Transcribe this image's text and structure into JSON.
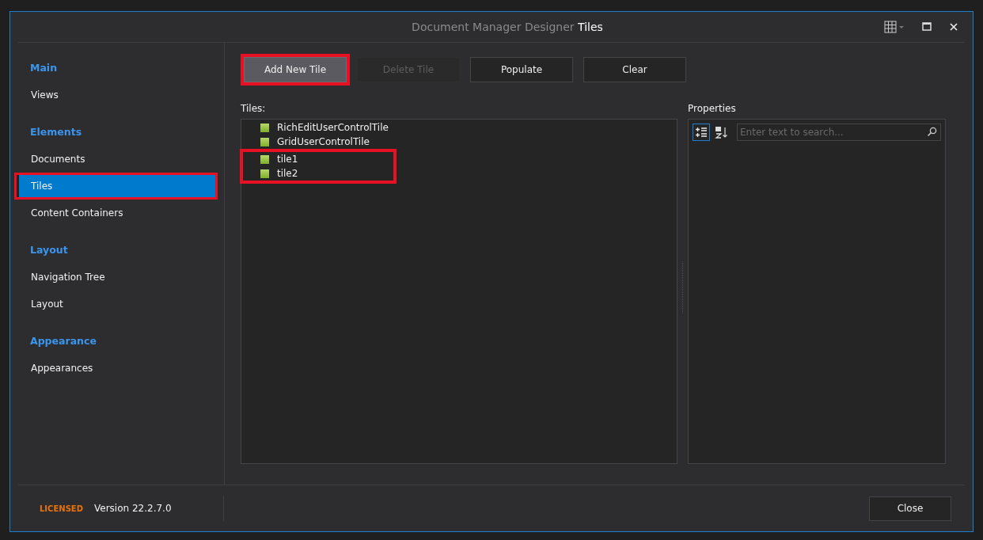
{
  "window": {
    "title": "Document Manager Designer",
    "title_accent": "Tiles"
  },
  "sidebar": {
    "groups": [
      {
        "heading": "Main",
        "items": [
          {
            "label": "Views",
            "selected": false,
            "highlighted": false
          }
        ]
      },
      {
        "heading": "Elements",
        "items": [
          {
            "label": "Documents",
            "selected": false,
            "highlighted": false
          },
          {
            "label": "Tiles",
            "selected": true,
            "highlighted": true
          },
          {
            "label": "Content Containers",
            "selected": false,
            "highlighted": false
          }
        ]
      },
      {
        "heading": "Layout",
        "items": [
          {
            "label": "Navigation Tree",
            "selected": false,
            "highlighted": false
          },
          {
            "label": "Layout",
            "selected": false,
            "highlighted": false
          }
        ]
      },
      {
        "heading": "Appearance",
        "items": [
          {
            "label": "Appearances",
            "selected": false,
            "highlighted": false
          }
        ]
      }
    ]
  },
  "toolbar": [
    {
      "label": "Add New Tile",
      "disabled": false,
      "highlighted": true
    },
    {
      "label": "Delete Tile",
      "disabled": true,
      "highlighted": false
    },
    {
      "label": "Populate",
      "disabled": false,
      "highlighted": false
    },
    {
      "label": "Clear",
      "disabled": false,
      "highlighted": false
    }
  ],
  "tiles": {
    "label": "Tiles:",
    "items": [
      {
        "name": "RichEditUserControlTile",
        "highlighted": false
      },
      {
        "name": "GridUserControlTile",
        "highlighted": false
      },
      {
        "name": "tile1",
        "highlighted": true
      },
      {
        "name": "tile2",
        "highlighted": true
      }
    ]
  },
  "properties": {
    "label": "Properties",
    "search": {
      "placeholder": "Enter text to search..."
    }
  },
  "footer": {
    "license": "LICENSED",
    "version": "Version 22.2.7.0",
    "close": "Close"
  }
}
